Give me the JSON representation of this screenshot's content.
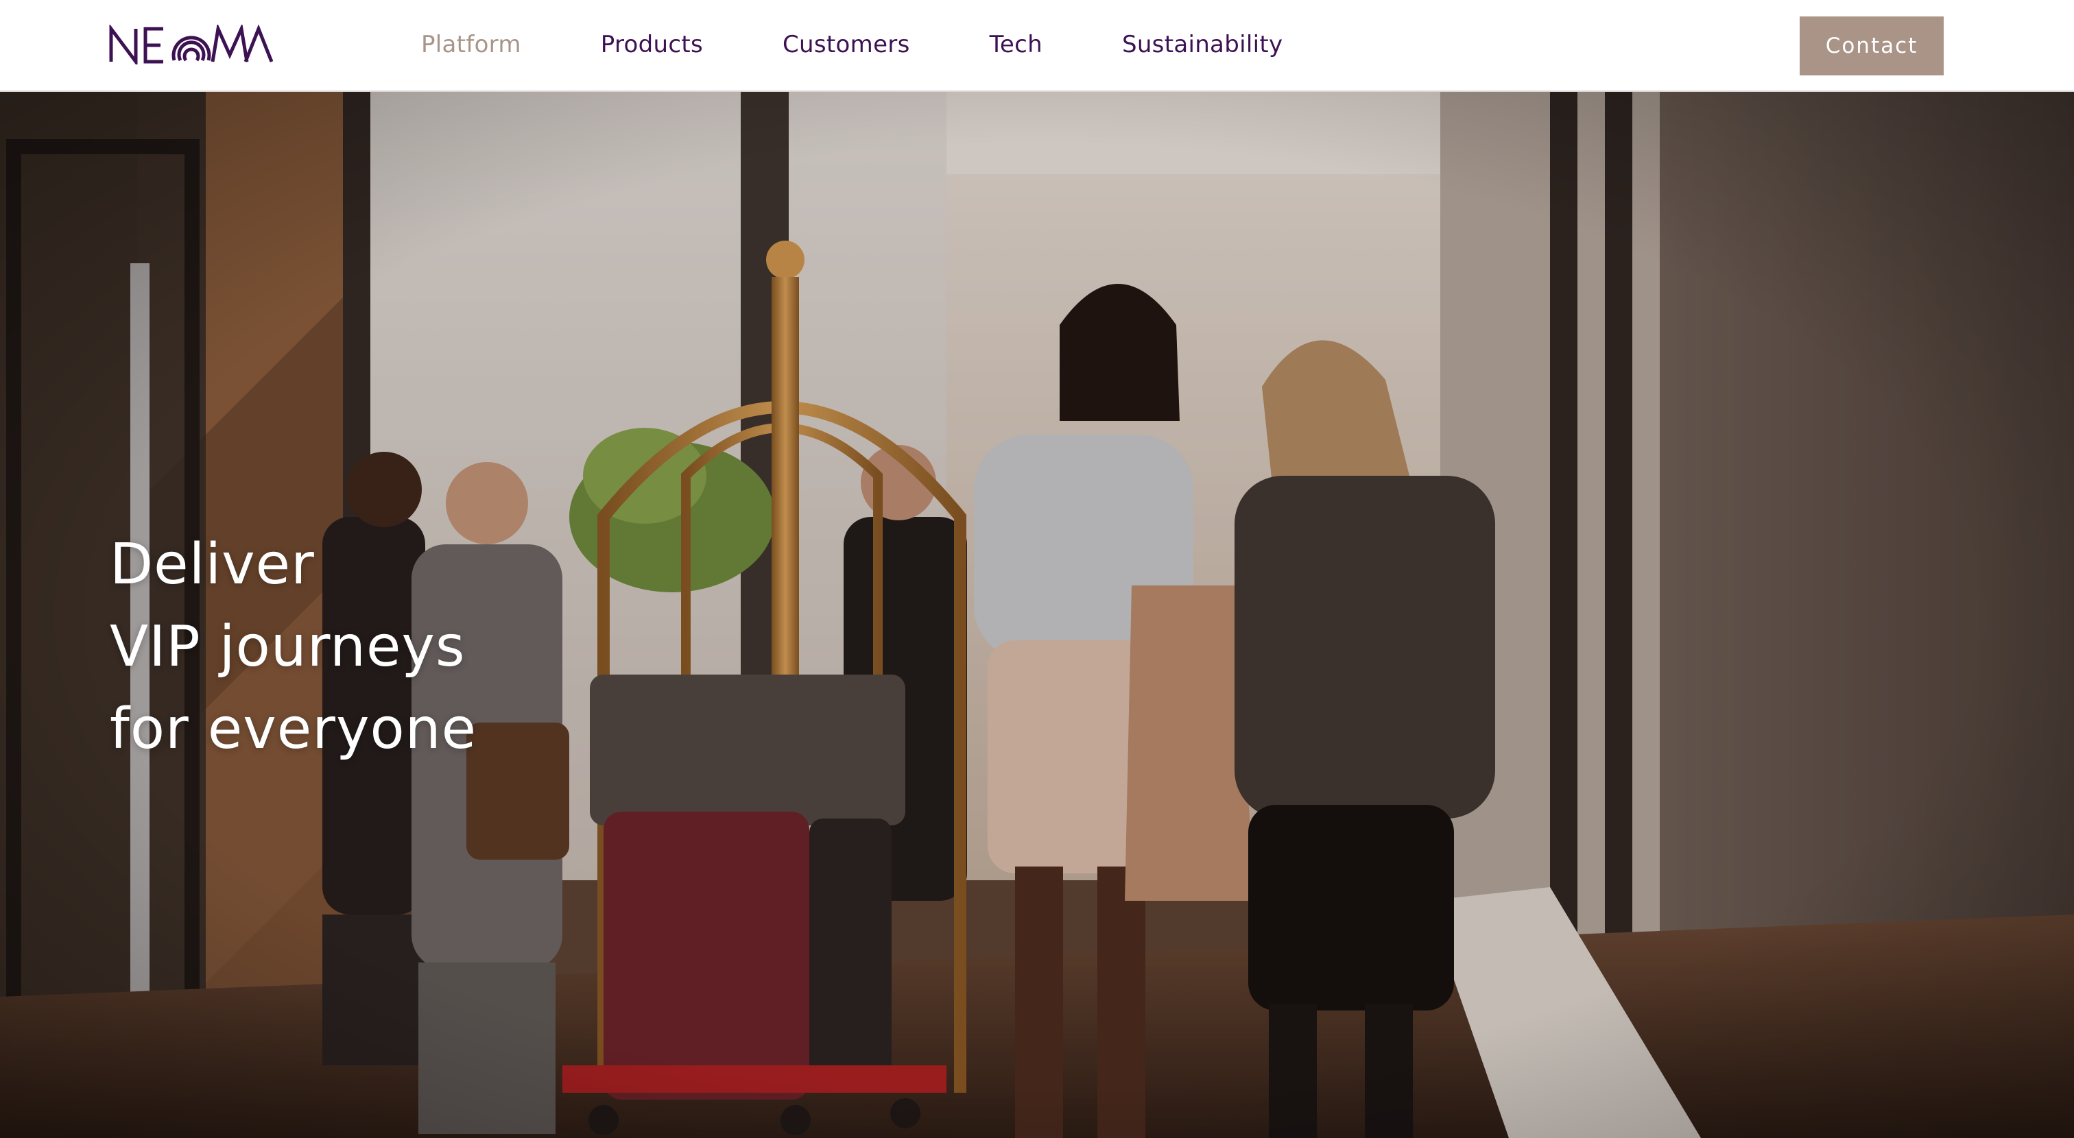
{
  "brand": {
    "name": "NEOMA",
    "primary_color": "#3c1253",
    "accent_color": "#a99487"
  },
  "nav": {
    "items": [
      {
        "label": "Platform",
        "active": true
      },
      {
        "label": "Products",
        "active": false
      },
      {
        "label": "Customers",
        "active": false
      },
      {
        "label": "Tech",
        "active": false
      },
      {
        "label": "Sustainability",
        "active": false
      }
    ],
    "contact_label": "Contact"
  },
  "hero": {
    "lines": [
      "Deliver",
      "VIP journeys",
      "for everyone"
    ],
    "image_description": "hotel-lobby-photo"
  }
}
